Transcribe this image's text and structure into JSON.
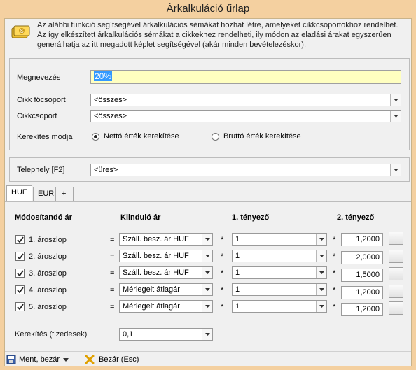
{
  "window": {
    "title": "Árkalkuláció űrlap"
  },
  "info": {
    "text": "Az alábbi funkció segítségével árkalkulációs sémákat hozhat létre, amelyeket cikkcsoportokhoz rendelhet. Az így elkészített árkalkulációs sémákat a cikkekhez rendelheti, ily módon az eladási árakat egyszerűen generálhatja az itt megadott képlet segítségével (akár minden bevételezéskor)."
  },
  "form": {
    "name_label": "Megnevezés",
    "name_value": "20%",
    "main_group_label": "Cikk főcsoport",
    "main_group_value": "<összes>",
    "group_label": "Cikkcsoport",
    "group_value": "<összes>",
    "rounding_mode_label": "Kerekítés módja",
    "rounding_net_label": "Nettó érték kerekítése",
    "rounding_gross_label": "Bruttó érték kerekítése",
    "site_label": "Telephely [F2]",
    "site_value": "<üres>"
  },
  "tabs": [
    {
      "label": "HUF"
    },
    {
      "label": "EUR"
    },
    {
      "label": "+"
    }
  ],
  "grid": {
    "col_modified": "Módosítandó ár",
    "col_start": "Kiinduló ár",
    "col_factor1": "1. tényező",
    "col_factor2": "2. tényező",
    "eq": "=",
    "mul": "*",
    "rows": [
      {
        "label": "1. ároszlop",
        "start": "Száll. besz. ár HUF",
        "factor1": "1",
        "factor2": "1,2000"
      },
      {
        "label": "2. ároszlop",
        "start": "Száll. besz. ár HUF",
        "factor1": "1",
        "factor2": "2,0000"
      },
      {
        "label": "3. ároszlop",
        "start": "Száll. besz. ár HUF",
        "factor1": "1",
        "factor2": "1,5000"
      },
      {
        "label": "4. ároszlop",
        "start": "Mérlegelt átlagár",
        "factor1": "1",
        "factor2": "1,2000"
      },
      {
        "label": "5. ároszlop",
        "start": "Mérlegelt átlagár",
        "factor1": "1",
        "factor2": "1,2000"
      }
    ],
    "decimals_label": "Kerekítés (tizedesek)",
    "decimals_value": "0,1"
  },
  "footer": {
    "save_label": "Ment, bezár",
    "close_label": "Bezár (Esc)"
  }
}
